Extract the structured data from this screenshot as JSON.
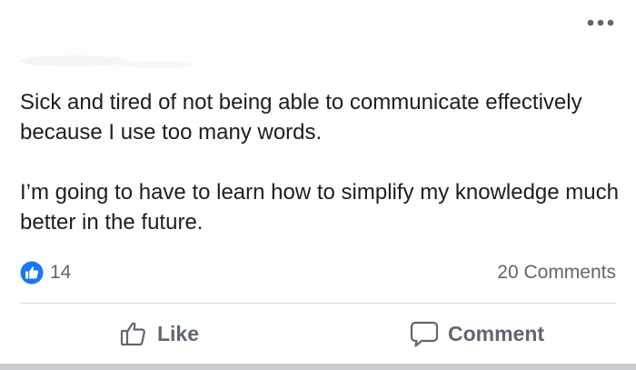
{
  "post": {
    "menu_icon": "more-horizontal-icon",
    "paragraphs": [
      "Sick and tired of not being able to communicate effectively because I use too many words.",
      "I’m going to have to learn how to simplify my knowledge much better in the future."
    ]
  },
  "stats": {
    "reaction_icon": "like-reaction-icon",
    "reaction_count": "14",
    "comments_label": "20 Comments"
  },
  "actions": {
    "like_label": "Like",
    "like_icon": "thumbs-up-outline-icon",
    "comment_label": "Comment",
    "comment_icon": "speech-bubble-icon"
  },
  "colors": {
    "like_blue": "#1877f2",
    "secondary_text": "#606770",
    "primary_text": "#1c1e21",
    "divider": "#dadde1"
  }
}
